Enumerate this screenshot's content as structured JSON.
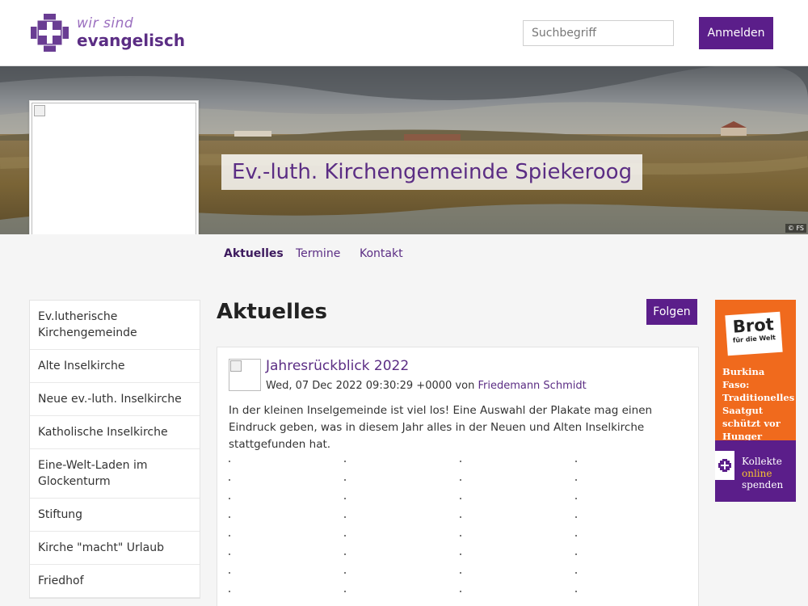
{
  "header": {
    "logo_line1": "wir sind",
    "logo_line2": "evangelisch",
    "search_placeholder": "Suchbegriff",
    "login_label": "Anmelden",
    "brand_color": "#5b1e8a"
  },
  "banner": {
    "title": "Ev.-luth. Kirchengemeinde Spiekeroog",
    "copyright": "© FS"
  },
  "nav": {
    "tabs": [
      {
        "label": "Aktuelles",
        "active": true
      },
      {
        "label": "Termine",
        "active": false
      },
      {
        "label": "Kontakt",
        "active": false
      }
    ]
  },
  "sidebar": {
    "items": [
      {
        "label": "Ev.lutherische Kirchengemeinde"
      },
      {
        "label": "Alte Inselkirche"
      },
      {
        "label": "Neue ev.-luth. Inselkirche"
      },
      {
        "label": "Katholische Inselkirche"
      },
      {
        "label": "Eine-Welt-Laden im Glockenturm"
      },
      {
        "label": "Stiftung"
      },
      {
        "label": "Kirche \"macht\" Urlaub"
      },
      {
        "label": "Friedhof"
      }
    ]
  },
  "main": {
    "heading": "Aktuelles",
    "follow_label": "Folgen",
    "post": {
      "title": "Jahresrückblick 2022",
      "date": "Wed, 07 Dec 2022 09:30:29 +0000",
      "by": "von",
      "author": "Friedemann Schmidt",
      "body": "In der kleinen Inselgemeinde ist viel los! Eine Auswahl der Plakate mag einen Eindruck geben, was in diesem Jahr alles in der Neuen und Alten Inselkirche stattgefunden hat."
    }
  },
  "ad": {
    "logo_main": "Brot",
    "logo_sub": "für die Welt",
    "text": "Burkina Faso: Traditionelles Saatgut schützt vor Hunger",
    "bottom_line1": "Kollekte",
    "bottom_line2": "online",
    "bottom_line3": "spenden",
    "colors": {
      "orange": "#f06a1d",
      "purple": "#5b1e8a",
      "highlight": "#f8c230"
    }
  }
}
